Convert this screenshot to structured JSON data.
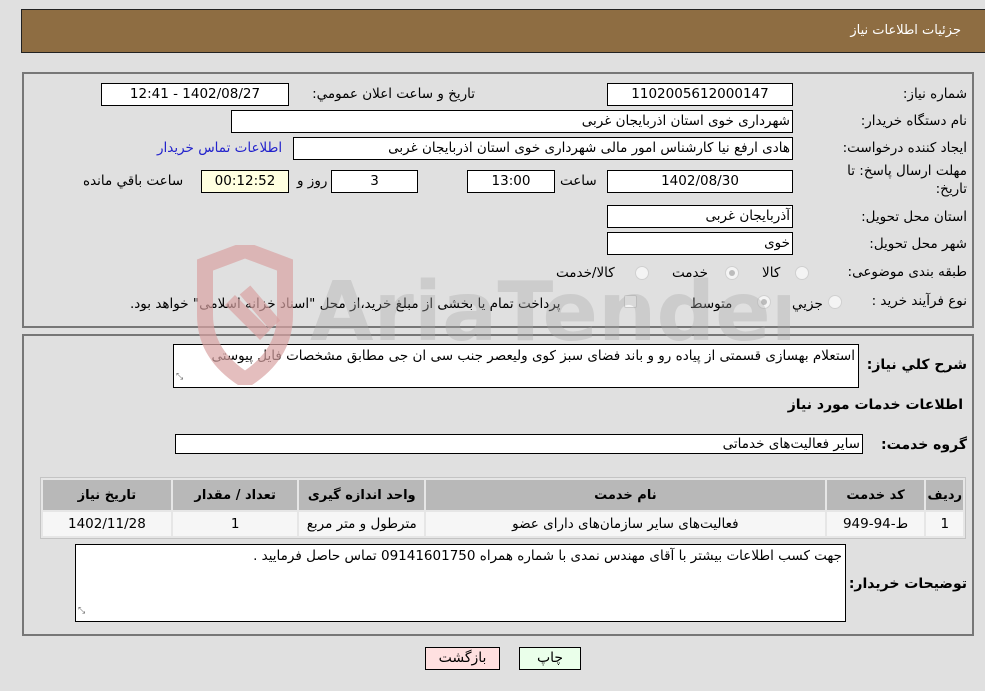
{
  "header": {
    "title": "جزئیات اطلاعات نیاز"
  },
  "form": {
    "need_number": {
      "label": "شماره نیاز:",
      "value": "1102005612000147"
    },
    "announce_datetime": {
      "label": "تاریخ و ساعت اعلان عمومي:",
      "value": "1402/08/27 - 12:41"
    },
    "buyer_org": {
      "label": "نام دستگاه خريدار:",
      "value": "شهرداری خوی استان اذربایجان غربی"
    },
    "requester": {
      "label": "ايجاد كننده درخواست:",
      "value": "هادی ارفع نیا کارشناس امور مالی شهرداری خوی استان اذربایجان غربی"
    },
    "contact_link": "اطلاعات تماس خريدار",
    "deadline": {
      "label_line1": "مهلت ارسال پاسخ: تا",
      "label_line2": "تاريخ:",
      "date": "1402/08/30",
      "time_label": "ساعت",
      "time": "13:00",
      "days": "3",
      "days_label": "روز و",
      "remaining": "00:12:52",
      "remaining_label": "ساعت باقي مانده"
    },
    "delivery_province": {
      "label": "استان محل تحويل:",
      "value": "آذربایجان غربی"
    },
    "delivery_city": {
      "label": "شهر محل تحويل:",
      "value": "خوی"
    },
    "category": {
      "label": "طبقه بندی موضوعی:",
      "options": [
        "کالا",
        "خدمت",
        "کالا/خدمت"
      ],
      "selected": "خدمت"
    },
    "process_type": {
      "label": "نوع فرآيند خريد :",
      "options": [
        "جزيي",
        "متوسط"
      ],
      "selected": "متوسط",
      "treasury_note": "پرداخت تمام یا بخشی از مبلغ خرید،از محل \"اسناد خزانه اسلامی\" خواهد بود.",
      "treasury_checked": false
    }
  },
  "description": {
    "label": "شرح كلي نياز:",
    "value": "استعلام بهسازی قسمتی از پیاده رو و باند فضای سبز کوی ولیعصر جنب سی ان جی مطابق مشخصات فایل پیوستی"
  },
  "services": {
    "section_title": "اطلاعات خدمات مورد نياز",
    "group_label": "گروه خدمت:",
    "group_value": "سایر فعالیت‌های خدماتی",
    "table": {
      "headers": [
        "رديف",
        "كد خدمت",
        "نام خدمت",
        "واحد اندازه گيری",
        "تعداد / مقدار",
        "تاريخ نياز"
      ],
      "rows": [
        [
          "1",
          "ط-94-949",
          "فعالیت‌های سایر سازمان‌های دارای عضو",
          "مترطول و متر مربع",
          "1",
          "1402/11/28"
        ]
      ]
    }
  },
  "buyer_notes": {
    "label": "توضيحات خريدار:",
    "value": "جهت کسب اطلاعات بیشتر با آقای مهندس نمدی با شماره همراه 09141601750 تماس حاصل فرمایید ."
  },
  "buttons": {
    "print": "چاپ",
    "back": "بازگشت"
  },
  "watermark": {
    "text": "AriaTender.neT"
  }
}
